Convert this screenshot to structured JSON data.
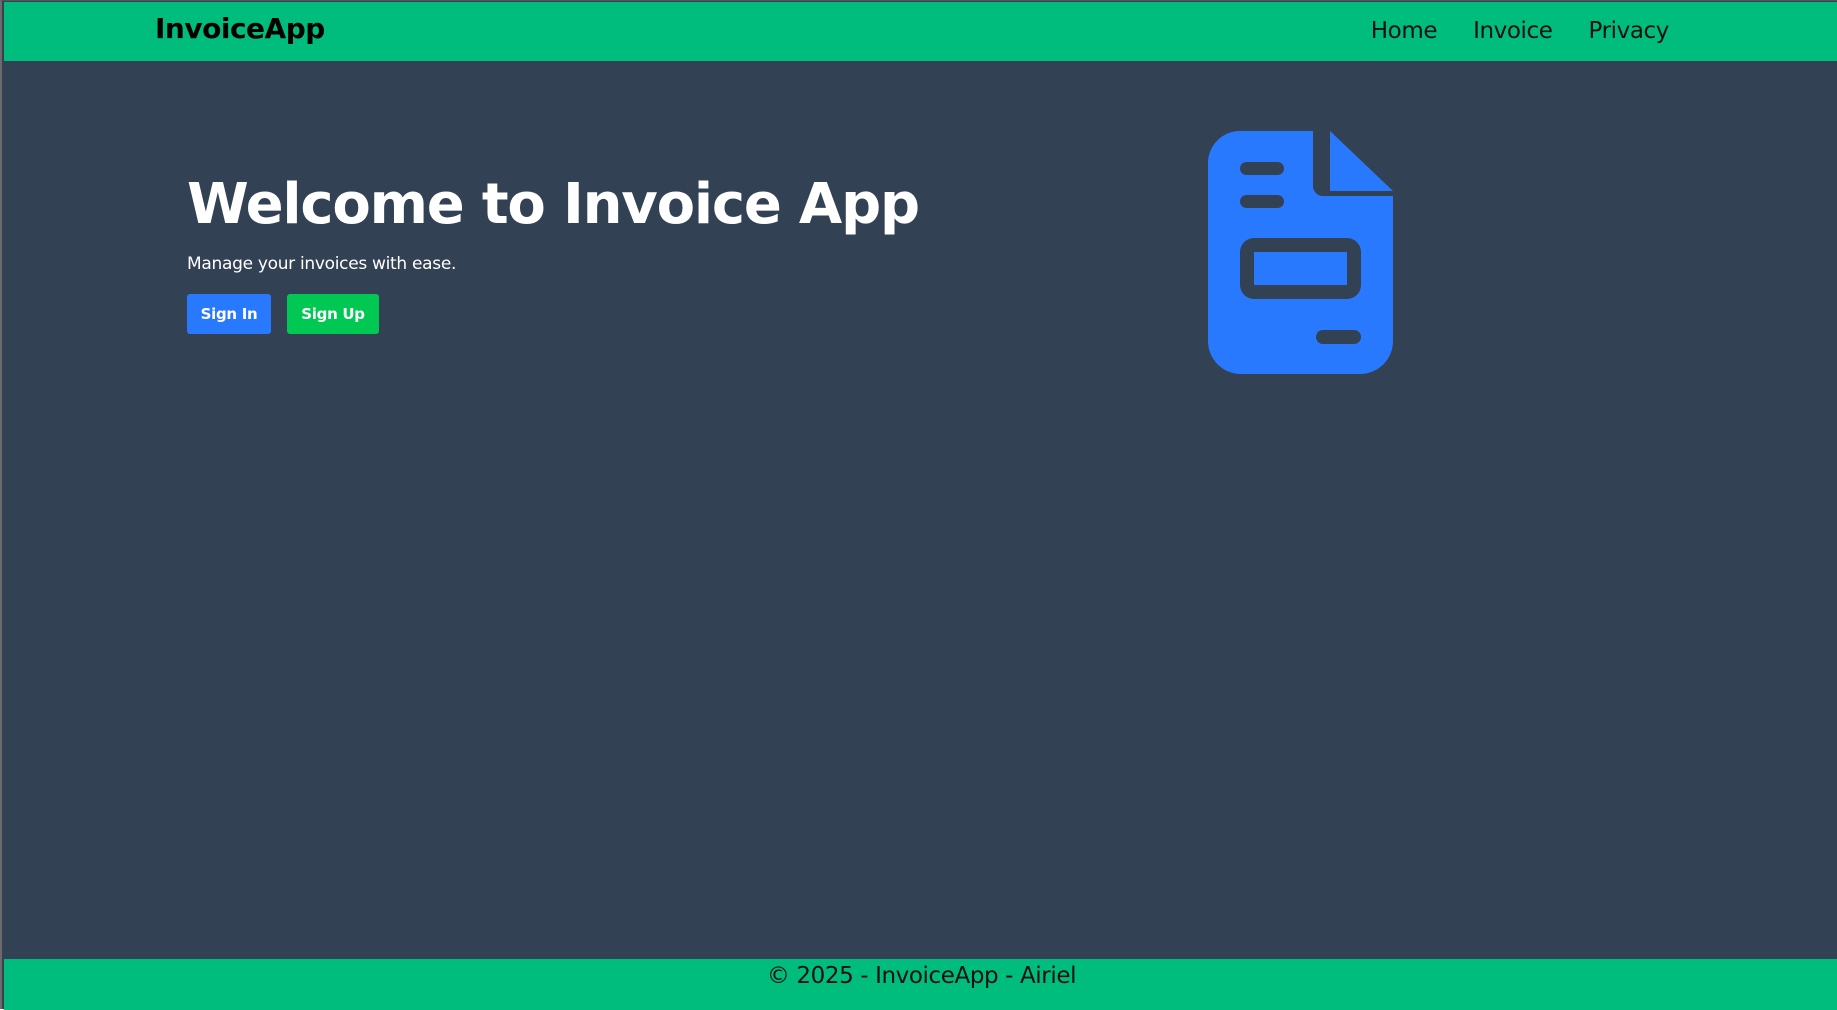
{
  "navbar": {
    "brand": "InvoiceApp",
    "links": [
      {
        "label": "Home"
      },
      {
        "label": "Invoice"
      },
      {
        "label": "Privacy"
      }
    ]
  },
  "hero": {
    "title": "Welcome to Invoice App",
    "subtitle": "Manage your invoices with ease.",
    "signin_label": "Sign In",
    "signup_label": "Sign Up",
    "illustration_icon": "invoice-document-icon"
  },
  "footer": {
    "text": "© 2025 - InvoiceApp - Airiel"
  },
  "colors": {
    "navbar_bg": "#00bd7e",
    "main_bg": "#334155",
    "signin_bg": "#2979ff",
    "signup_bg": "#00c853",
    "icon_color": "#2979ff"
  }
}
